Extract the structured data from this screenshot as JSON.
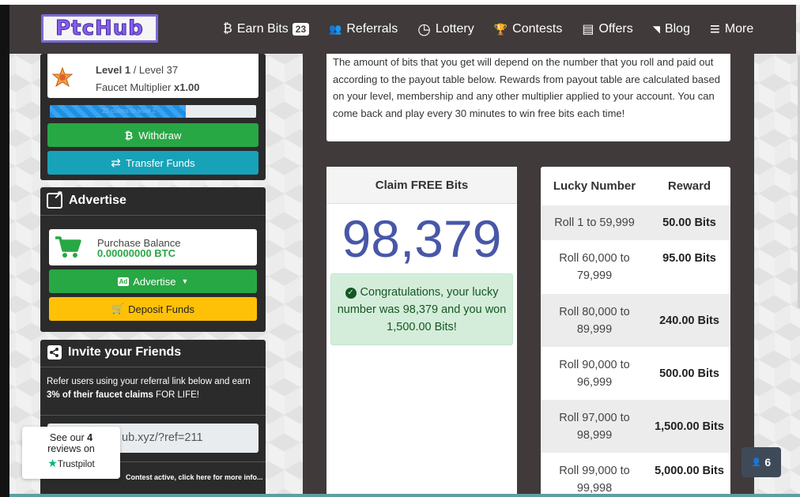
{
  "nav": {
    "logo": "PtcHub",
    "items": [
      {
        "label": "Earn Bits",
        "icon": "bitcoin-icon",
        "glyph": "₿",
        "badge": "23"
      },
      {
        "label": "Referrals",
        "icon": "users-icon",
        "glyph": "👥"
      },
      {
        "label": "Lottery",
        "icon": "clock-icon",
        "glyph": "◷"
      },
      {
        "label": "Contests",
        "icon": "trophy-icon",
        "glyph": "🏆"
      },
      {
        "label": "Offers",
        "icon": "list-icon",
        "glyph": "▤"
      },
      {
        "label": "Blog",
        "icon": "rss-icon",
        "glyph": "◥"
      },
      {
        "label": "More",
        "icon": "menu-icon",
        "glyph": "≡"
      }
    ]
  },
  "level": {
    "current": "Level 1",
    "separator": " / Level 37",
    "multiplier_label": "Faucet Multiplier ",
    "multiplier_value": "x1.00",
    "progress_text": "25 claims to level 2",
    "progress_fraction": 0.66
  },
  "buttons": {
    "withdraw": "Withdraw",
    "transfer": "Transfer Funds",
    "advertise": "Advertise",
    "deposit": "Deposit Funds"
  },
  "advertise": {
    "title": "Advertise",
    "purchase_label": "Purchase Balance",
    "purchase_value": "0.00000000 BTC"
  },
  "invite": {
    "title": "Invite your Friends",
    "text1": "Refer users using your referral link below and earn ",
    "text_bold": "3% of their faucet claims",
    "text2": " FOR LIFE!",
    "link": "ub.xyz/?ref=211",
    "contest": "Contest active, click here for more info..."
  },
  "trustpilot": {
    "line1": "See our ",
    "count": "4",
    "line2": "reviews on",
    "brand": "Trustpilot"
  },
  "info_text": "The amount of bits that you get will depend on the number that you roll and paid out according to the payout table below. Rewards from payout table are calculated based on your level, membership and any other multiplier applied to your account. You can come back and play every 30 minutes to win free bits each time!",
  "claim": {
    "title": "Claim FREE Bits",
    "number": "98,379",
    "alert": "Congratulations, your lucky number was 98,379 and you won 1,500.00 Bits!"
  },
  "payout": {
    "col1": "Lucky Number",
    "col2": "Reward",
    "rows": [
      {
        "range": "Roll 1 to 59,999",
        "reward": "50.00 Bits"
      },
      {
        "range": "Roll 60,000 to 79,999",
        "reward": "95.00 Bits"
      },
      {
        "range": "Roll 80,000 to 89,999",
        "reward": "240.00 Bits"
      },
      {
        "range": "Roll 90,000 to 96,999",
        "reward": "500.00 Bits"
      },
      {
        "range": "Roll 97,000 to 98,999",
        "reward": "1,500.00 Bits"
      },
      {
        "range": "Roll 99,000 to 99,998",
        "reward": "5,000.00 Bits"
      }
    ]
  },
  "online_users": "6",
  "colors": {
    "nav_bg": "#403a3b",
    "green": "#28a745",
    "cyan": "#17a2b8",
    "yellow": "#ffc107",
    "number": "#4857a8"
  }
}
